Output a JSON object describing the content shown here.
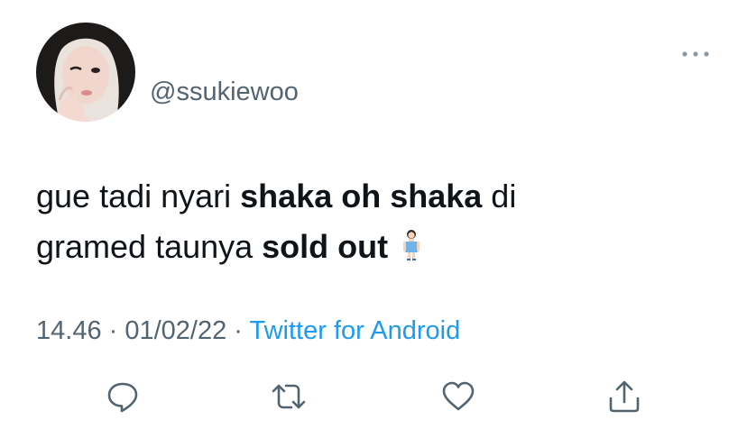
{
  "user": {
    "handle": "@ssukiewoo",
    "avatar_icon": "profile-photo"
  },
  "tweet": {
    "line1_pre": "gue tadi nyari ",
    "line1_bold": "shaka oh shaka",
    "line1_post": " di",
    "line2_pre": "gramed taunya ",
    "line2_bold": "sold out",
    "emoji_icon": "woman-standing-emoji"
  },
  "meta": {
    "time": "14.46",
    "separator": " · ",
    "date": "01/02/22",
    "source": "Twitter for Android"
  },
  "actions": {
    "icons": [
      "reply-icon",
      "retweet-icon",
      "like-icon",
      "share-icon"
    ],
    "color": "#536471"
  },
  "colors": {
    "text": "#0f1419",
    "secondary": "#536471",
    "link": "#1d9bf0",
    "background": "#ffffff"
  }
}
